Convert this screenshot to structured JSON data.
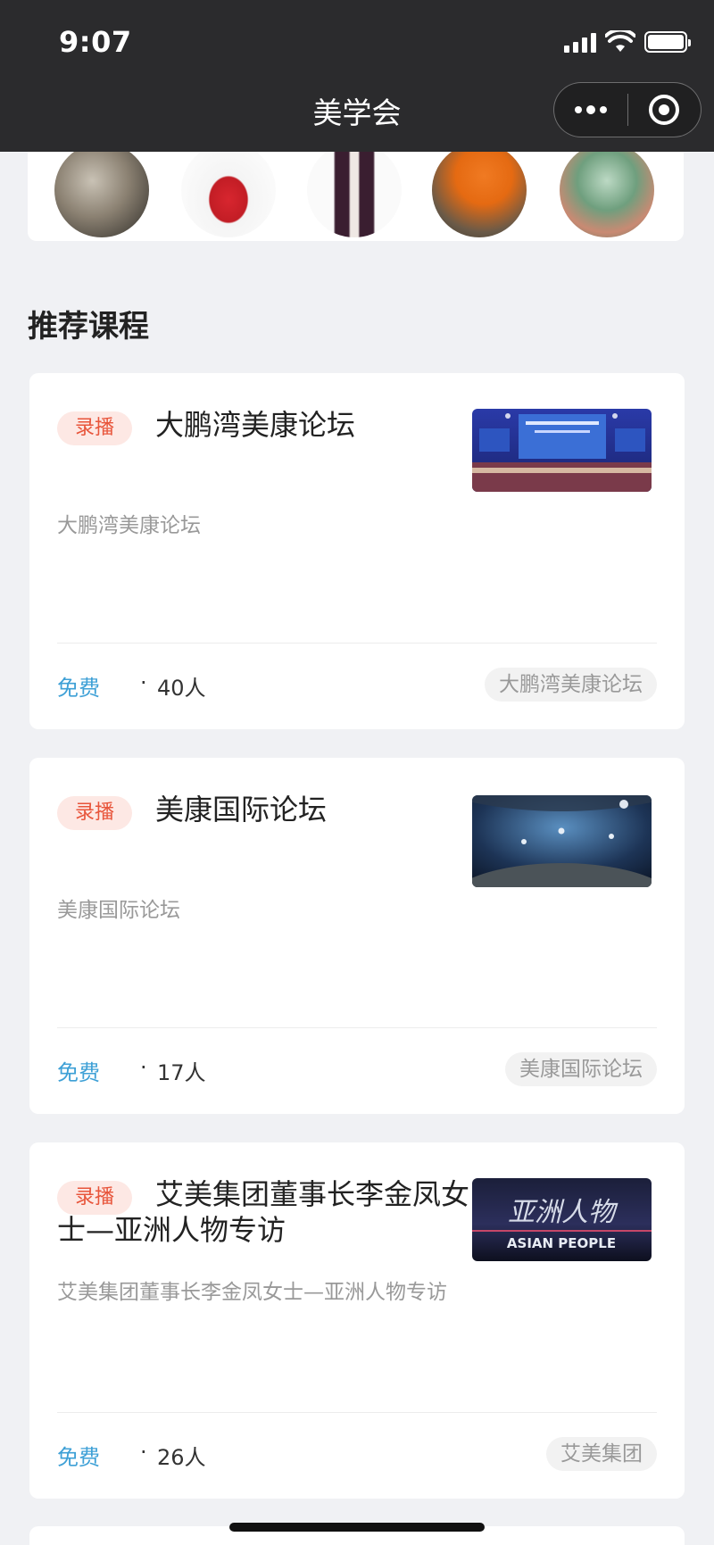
{
  "status_bar": {
    "time": "9:07"
  },
  "nav": {
    "title": "美学会"
  },
  "colors": {
    "accent_blue": "#3ea0d6",
    "badge_red": "#e8553b",
    "badge_bg": "#fde8e4"
  },
  "section": {
    "title": "推荐课程"
  },
  "courses": [
    {
      "badge": "录播",
      "title": "大鹏湾美康论坛",
      "desc": "大鹏湾美康论坛",
      "price": "免费",
      "dot": "·",
      "count": "40人",
      "tag": "大鹏湾美康论坛",
      "thumb_icon": "forum-stage-photo"
    },
    {
      "badge": "录播",
      "title": "美康国际论坛",
      "desc": "美康国际论坛",
      "price": "免费",
      "dot": "·",
      "count": "17人",
      "tag": "美康国际论坛",
      "thumb_icon": "space-planet-photo"
    },
    {
      "badge": "录播",
      "title": "艾美集团董事长李金凤女士—亚洲人物专访",
      "desc": "艾美集团董事长李金凤女士—亚洲人物专访",
      "price": "免费",
      "dot": "·",
      "count": "26人",
      "tag": "艾美集团",
      "thumb_icon": "asian-people-banner",
      "thumb_cn": "亚洲人物",
      "thumb_en": "ASIAN PEOPLE"
    }
  ]
}
